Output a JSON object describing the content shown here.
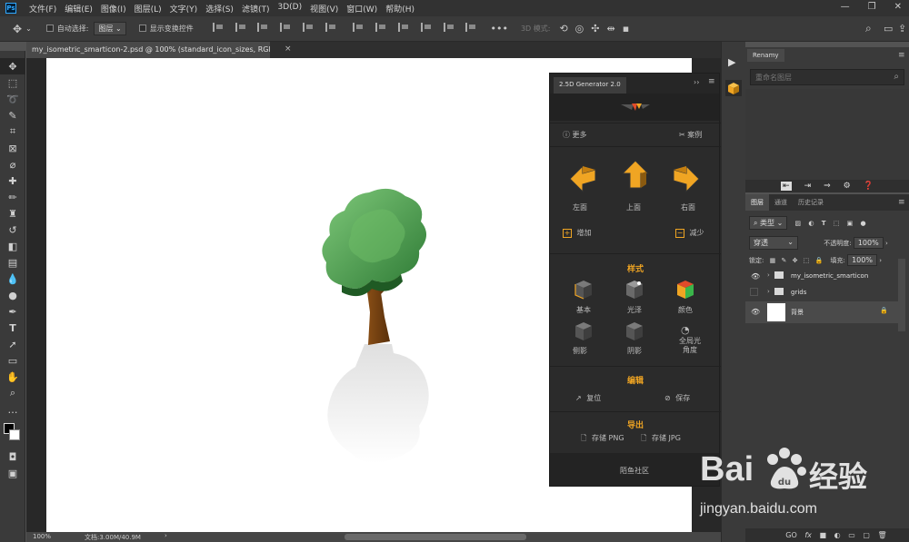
{
  "app": {
    "logo": "Ps",
    "menu": [
      "文件(F)",
      "编辑(E)",
      "图像(I)",
      "图层(L)",
      "文字(Y)",
      "选择(S)",
      "滤镜(T)",
      "3D(D)",
      "视图(V)",
      "窗口(W)",
      "帮助(H)"
    ]
  },
  "options_bar": {
    "auto_select_label": "自动选择:",
    "auto_select_value": "图层",
    "show_transform_label": "显示变换控件",
    "more": "•••",
    "mode_3d": "3D 模式:"
  },
  "document": {
    "tab_title": "my_isometric_smarticon-2.psd @ 100% (standard_icon_sizes, RGB/8) *",
    "close": "×"
  },
  "status": {
    "zoom": "100%",
    "doc_info": "文档:3.00M/40.9M",
    "arrow": "›"
  },
  "plugin": {
    "tab": "2.5D Generator 2.0",
    "more_label": "更多",
    "cases_label": "案例",
    "directions": [
      "左面",
      "上面",
      "右面"
    ],
    "add_label": "增加",
    "reduce_label": "减少",
    "style_title": "样式",
    "styles": [
      "基本",
      "光泽",
      "颜色"
    ],
    "styles2": [
      "侧影",
      "阴影",
      "全局光\n角度"
    ],
    "edit_title": "编辑",
    "reset_label": "复位",
    "save_label": "保存",
    "export_title": "导出",
    "save_png": "存储 PNG",
    "save_jpg": "存储 JPG",
    "community": "陌鱼社区"
  },
  "renamy": {
    "tab": "Renamy",
    "search_placeholder": "重命名图层"
  },
  "layers": {
    "tabs": [
      "图层",
      "通道",
      "历史记录"
    ],
    "filter_label": "类型",
    "blend_mode": "穿透",
    "opacity_label": "不透明度:",
    "opacity_value": "100%",
    "lock_label": "锁定:",
    "fill_label": "填充:",
    "fill_value": "100%",
    "items": [
      {
        "name": "my_isometric_smarticon",
        "visible": true
      },
      {
        "name": "grids",
        "visible": false
      },
      {
        "name": "背景",
        "visible": true
      }
    ],
    "bottom_icons": [
      "GO",
      "fx",
      "■",
      "◐",
      "▭",
      "▢",
      "🗑"
    ]
  },
  "watermark": {
    "brand": "Bai",
    "brand_cn": "经验",
    "url": "jingyan.baidu.com"
  },
  "colors": {
    "accent": "#f0a523",
    "ps_blue": "#31a8ff"
  }
}
